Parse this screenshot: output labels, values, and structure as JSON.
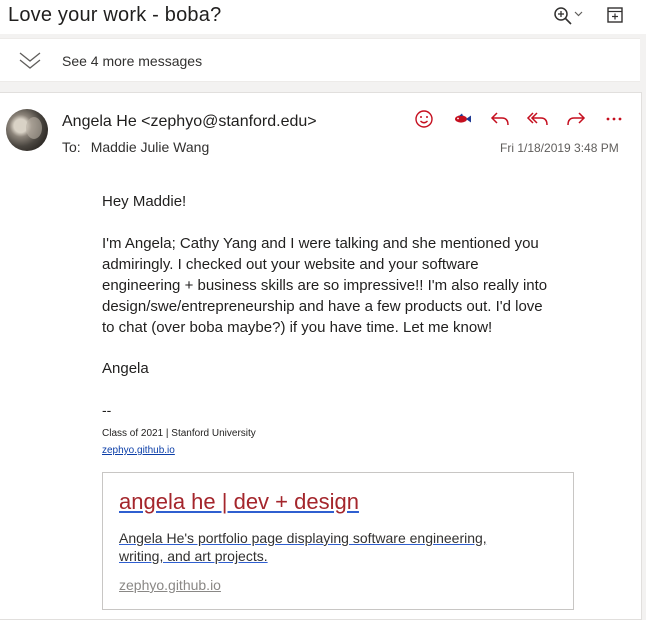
{
  "email": {
    "subject": "Love your work - boba?",
    "thread": {
      "more_messages": "See 4 more messages"
    },
    "message": {
      "from": "Angela He <zephyo@stanford.edu>",
      "to_label": "To:",
      "to": "Maddie Julie Wang",
      "datetime": "Fri 1/18/2019 3:48 PM",
      "greeting": "Hey Maddie!",
      "paragraph_lines": [
        "I'm Angela; Cathy Yang and I were talking and she mentioned you",
        "admiringly. I checked out your website and your software",
        "engineering + business skills are so impressive!! I'm also really into",
        "design/swe/entrepreneurship and have a few products out. I'd love",
        "to chat (over boba maybe?) if you have time. Let me know!"
      ],
      "signoff": "Angela",
      "signature": {
        "dashes": "--",
        "line": "Class of 2021 | Stanford University",
        "link": "zephyo.github.io"
      },
      "link_preview": {
        "title": "angela he | dev + design",
        "description_lines": [
          "Angela He's portfolio page displaying software engineering,",
          "writing, and art projects."
        ],
        "url": "zephyo.github.io"
      }
    }
  },
  "icons": {
    "zoom": "zoom-in-icon",
    "popout": "open-in-new-window-icon",
    "expand": "chevron-double-down-icon",
    "emoji": "smiley-icon",
    "teams": "fish-icon",
    "reply": "reply-icon",
    "reply_all": "reply-all-icon",
    "forward": "forward-icon",
    "more": "more-actions-icon"
  },
  "colors": {
    "accent": "#c50f1f",
    "link": "#0b3ea8",
    "preview_title": "#a4262c"
  }
}
